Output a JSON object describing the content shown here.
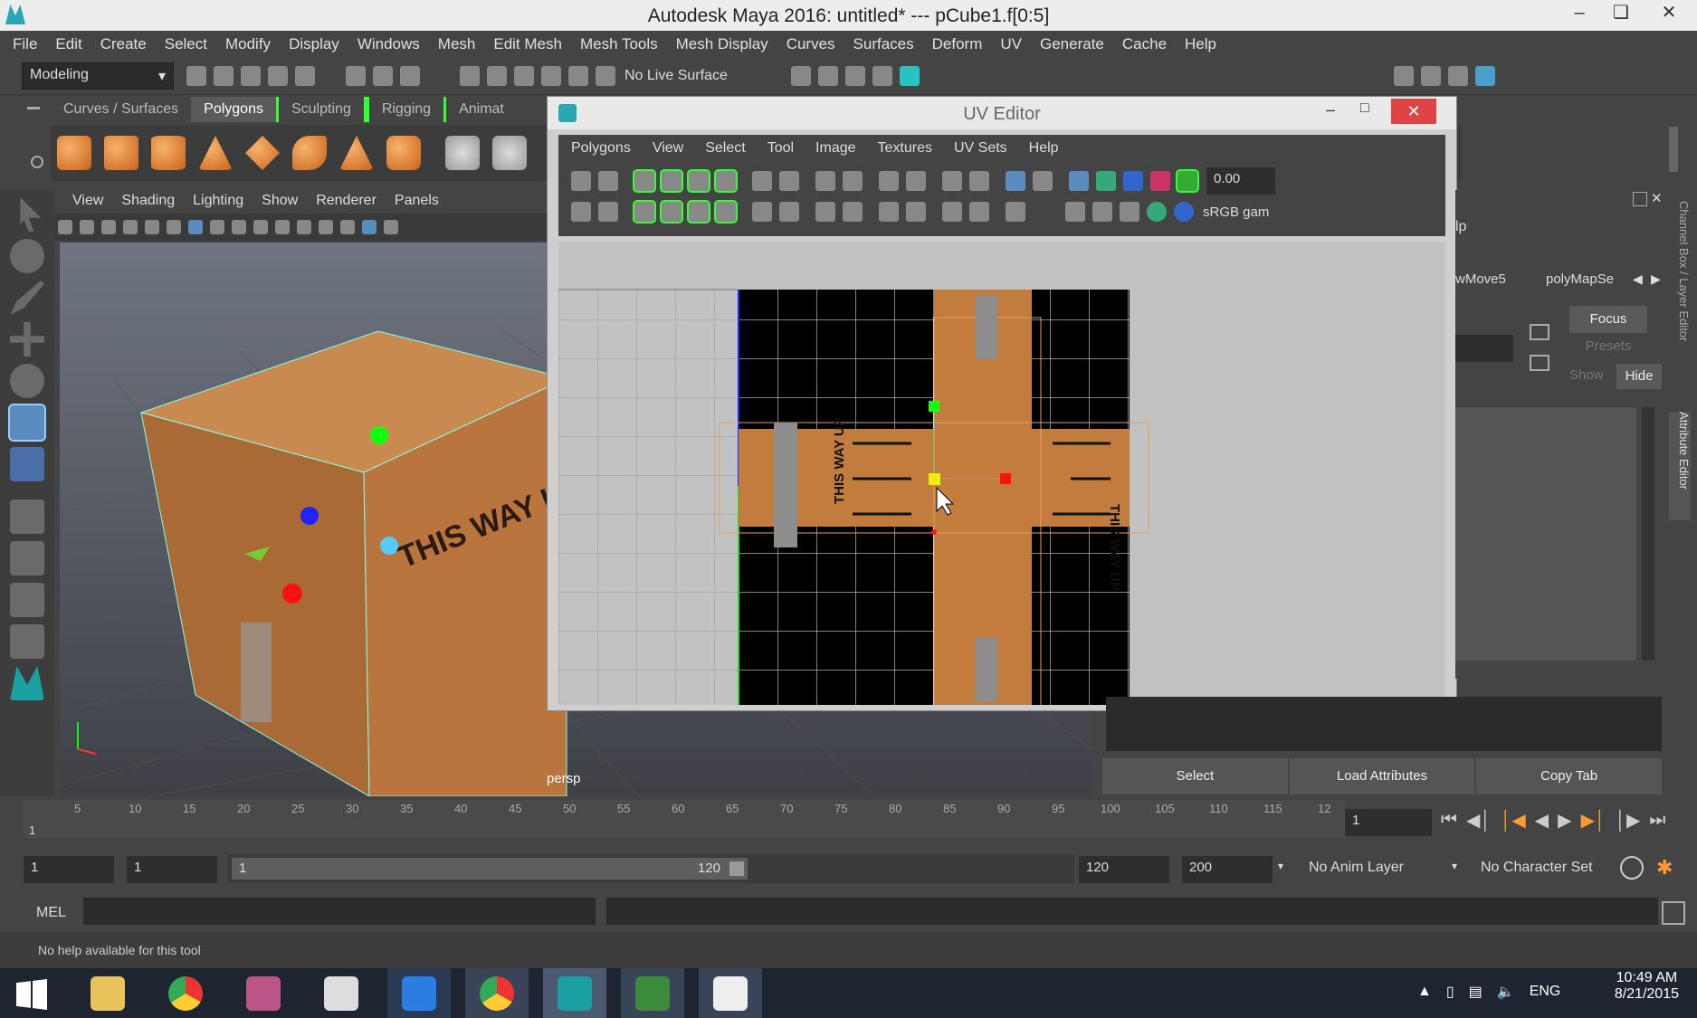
{
  "window": {
    "title": "Autodesk Maya 2016: untitled*   ---   pCube1.f[0:5]"
  },
  "menubar": [
    "File",
    "Edit",
    "Create",
    "Select",
    "Modify",
    "Display",
    "Windows",
    "Mesh",
    "Edit Mesh",
    "Mesh Tools",
    "Mesh Display",
    "Curves",
    "Surfaces",
    "Deform",
    "UV",
    "Generate",
    "Cache",
    "Help"
  ],
  "status": {
    "mode": "Modeling",
    "live_surface": "No Live Surface"
  },
  "shelf": {
    "tabs": [
      "Curves / Surfaces",
      "Polygons",
      "Sculpting",
      "Rigging",
      "Animat"
    ],
    "active_tab": "Polygons"
  },
  "viewport": {
    "menus": [
      "View",
      "Shading",
      "Lighting",
      "Show",
      "Renderer",
      "Panels"
    ],
    "camera_label": "persp",
    "box_text": "THIS WAY UP"
  },
  "uv_editor": {
    "title": "UV Editor",
    "menus": [
      "Polygons",
      "View",
      "Select",
      "Tool",
      "Image",
      "Textures",
      "UV Sets",
      "Help"
    ],
    "exposure_value": "0.00",
    "colorspace": "sRGB gam",
    "box_text": "THIS WAY UP"
  },
  "channel_box": {
    "tabs": [
      "wMove5",
      "polyMapSe"
    ],
    "buttons": {
      "focus": "Focus",
      "presets": "Presets",
      "show": "Show",
      "hide": "Hide"
    },
    "side_label_top": "Channel Box / Layer Editor",
    "side_label_attr": "Attribute Editor",
    "partial_text": "lp"
  },
  "attr_buttons": [
    "Select",
    "Load Attributes",
    "Copy Tab"
  ],
  "timeline": {
    "ticks": [
      "5",
      "10",
      "15",
      "20",
      "25",
      "30",
      "35",
      "40",
      "45",
      "50",
      "55",
      "60",
      "65",
      "70",
      "75",
      "80",
      "85",
      "90",
      "95",
      "100",
      "105",
      "110",
      "115",
      "12"
    ],
    "start_marker": "1",
    "current_frame": "1"
  },
  "range": {
    "start": "1",
    "playback_start": "1",
    "slider_start": "1",
    "slider_end": "120",
    "playback_end": "120",
    "end": "200",
    "anim_layer": "No Anim Layer",
    "character_set": "No Character Set"
  },
  "command": {
    "language": "MEL"
  },
  "help": {
    "text": "No help available for this tool"
  },
  "taskbar": {
    "language": "ENG",
    "time": "10:49 AM",
    "date": "8/21/2015"
  }
}
